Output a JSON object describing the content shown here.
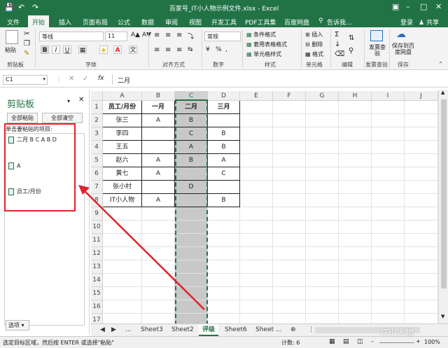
{
  "title": "百家号_IT小人物示例文件.xlsx - Excel",
  "tabs": [
    "文件",
    "开始",
    "插入",
    "页面布局",
    "公式",
    "数据",
    "审阅",
    "视图",
    "开发工具",
    "PDF工具集",
    "百度网盘"
  ],
  "tell_me": "告诉我...",
  "login": "登录",
  "share": "共享",
  "ribbon": {
    "paste": "粘贴",
    "clipboard": "剪贴板",
    "font_name": "等线",
    "font_size": "11",
    "font": "字体",
    "alignment": "对齐方式",
    "number_format": "常规",
    "number": "数字",
    "cond_format": "条件格式",
    "table_format": "套用表格格式",
    "cell_style": "单元格样式",
    "styles": "样式",
    "insert": "插入",
    "delete": "删除",
    "format": "格式",
    "cells": "单元格",
    "editing": "编辑",
    "invoice": "发票查验",
    "invoice_group": "发票查验",
    "save_baidu": "保存到百度网盘",
    "save_group": "保存"
  },
  "formula": {
    "namebox": "C1",
    "fx": "fx",
    "value": "二月"
  },
  "panel": {
    "title": "剪贴板",
    "paste_all": "全部粘贴",
    "clear_all": "全部清空",
    "hint": "单击要粘贴的项目:",
    "items": [
      "二月 B C A B D",
      "A",
      "员工/月份"
    ],
    "options": "选项"
  },
  "columns": [
    "A",
    "B",
    "C",
    "D",
    "E",
    "F",
    "G",
    "H",
    "I",
    "J"
  ],
  "rows": [
    "1",
    "2",
    "3",
    "4",
    "5",
    "6",
    "7",
    "8",
    "9",
    "10",
    "11",
    "12",
    "13",
    "14",
    "15",
    "16",
    "17"
  ],
  "table": [
    [
      "员工/月份",
      "一月",
      "二月",
      "三月"
    ],
    [
      "张三",
      "A",
      "B",
      ""
    ],
    [
      "李四",
      "",
      "C",
      "B"
    ],
    [
      "王五",
      "",
      "A",
      "B"
    ],
    [
      "赵六",
      "A",
      "B",
      "A"
    ],
    [
      "黄七",
      "A",
      "",
      "C"
    ],
    [
      "张小村",
      "",
      "D",
      ""
    ],
    [
      "IT小人物",
      "A",
      "",
      "B"
    ]
  ],
  "sheets": [
    "...",
    "Sheet3",
    "Sheet2",
    "评级",
    "Sheet6",
    "Sheet ..."
  ],
  "status": {
    "message": "选定目标区域，然后按 ENTER 或选择\"粘贴\"",
    "count": "计数: 6",
    "zoom": "100%"
  },
  "watermark": "IT小人物"
}
